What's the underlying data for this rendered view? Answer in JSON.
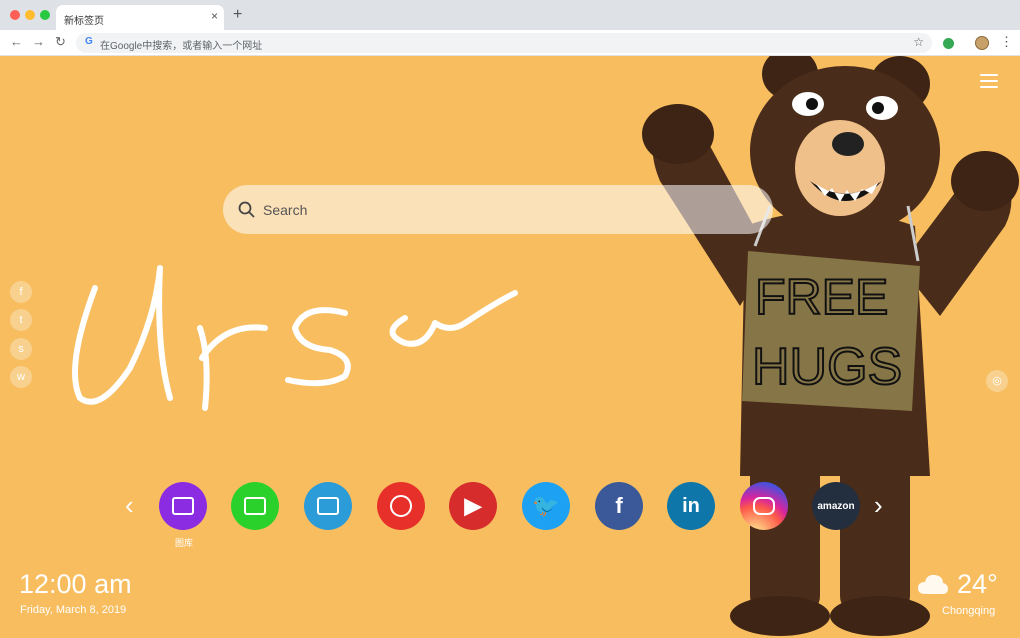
{
  "browser": {
    "tab_title": "新标签页",
    "tab_close": "×",
    "new_tab": "+",
    "address_placeholder": "在Google中搜索，或者输入一个网址",
    "nav": {
      "back": "←",
      "forward": "→",
      "reload": "↻"
    },
    "star": "☆",
    "menu": "⋮",
    "google_letter": "G"
  },
  "page": {
    "search_placeholder": "Search",
    "wallpaper_sign_line1": "FREE",
    "wallpaper_sign_line2": "HUGS",
    "social": [
      {
        "icon": "facebook-icon",
        "glyph": "f"
      },
      {
        "icon": "twitter-icon",
        "glyph": "t"
      },
      {
        "icon": "snapchat-icon",
        "glyph": "s"
      },
      {
        "icon": "wechat-icon",
        "glyph": "w"
      }
    ],
    "dock": {
      "prev": "‹",
      "next": "›",
      "apps": [
        {
          "name": "gallery",
          "color": "#8b2be2",
          "label": "图库"
        },
        {
          "name": "notes",
          "color": "#2bd12b"
        },
        {
          "name": "editor",
          "color": "#2b9cd8"
        },
        {
          "name": "games",
          "color": "#e8302a"
        },
        {
          "name": "youtube",
          "color": "#d62c2c",
          "glyph": "▶"
        },
        {
          "name": "twitter",
          "color": "#1da1f2",
          "glyph": "🐦"
        },
        {
          "name": "facebook",
          "color": "#3b5998",
          "glyph": "f"
        },
        {
          "name": "linkedin",
          "color": "#0e76a8",
          "glyph": "in"
        },
        {
          "name": "instagram",
          "color": "#d6249f"
        },
        {
          "name": "amazon",
          "color": "#232f3e",
          "glyph": "amazon"
        }
      ]
    },
    "clock": {
      "time": "12:00 am",
      "date": "Friday, March 8, 2019"
    },
    "weather": {
      "temp": "24°",
      "city": "Chongqing"
    }
  }
}
